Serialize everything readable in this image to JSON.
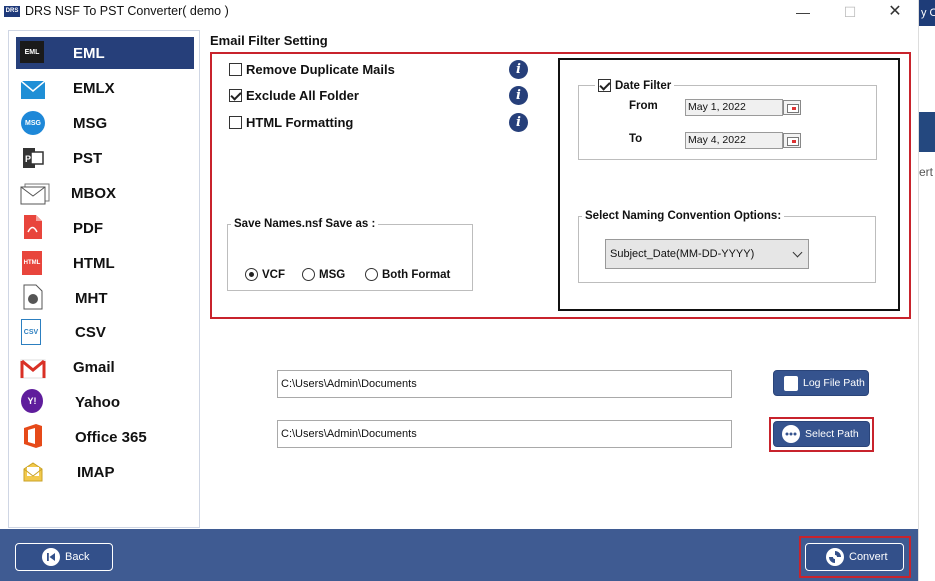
{
  "window": {
    "title": "DRS NSF To PST Converter( demo )",
    "logo_text": "DRS",
    "minimize": "—",
    "maximize": "☐",
    "close": "✕"
  },
  "background_window": {
    "top_text": "y O",
    "body_text": "ert"
  },
  "sidebar": {
    "items": [
      {
        "label": "EML",
        "icon": "eml-icon",
        "active": true
      },
      {
        "label": "EMLX",
        "icon": "envelope-icon"
      },
      {
        "label": "MSG",
        "icon": "msg-icon"
      },
      {
        "label": "PST",
        "icon": "pst-icon"
      },
      {
        "label": "MBOX",
        "icon": "mbox-icon"
      },
      {
        "label": "PDF",
        "icon": "pdf-icon"
      },
      {
        "label": "HTML",
        "icon": "html-icon"
      },
      {
        "label": "MHT",
        "icon": "mht-icon"
      },
      {
        "label": "CSV",
        "icon": "csv-icon"
      },
      {
        "label": "Gmail",
        "icon": "gmail-icon"
      },
      {
        "label": "Yahoo",
        "icon": "yahoo-icon"
      },
      {
        "label": "Office 365",
        "icon": "office365-icon"
      },
      {
        "label": "IMAP",
        "icon": "imap-icon"
      }
    ],
    "icon_text": {
      "eml": "EML",
      "msg": "MSG",
      "html": "HTML",
      "csv": "CSV",
      "yahoo": "Y!"
    }
  },
  "filter": {
    "section_title": "Email Filter Setting",
    "options": [
      {
        "label": "Remove Duplicate Mails",
        "checked": false
      },
      {
        "label": "Exclude All Folder",
        "checked": true
      },
      {
        "label": "HTML Formatting",
        "checked": false
      }
    ],
    "info_glyph": "i",
    "save_as": {
      "legend": "Save Names.nsf Save as :",
      "options": [
        {
          "label": "VCF",
          "selected": true
        },
        {
          "label": "MSG",
          "selected": false
        },
        {
          "label": "Both Format",
          "selected": false
        }
      ]
    },
    "date_filter": {
      "label": "Date Filter",
      "checked": true,
      "from_label": "From",
      "from_value": "May 1, 2022",
      "to_label": "To",
      "to_value": "May 4, 2022"
    },
    "naming": {
      "legend": "Select Naming Convention Options:",
      "selected": "Subject_Date(MM-DD-YYYY)"
    }
  },
  "paths": {
    "log_path": "C:\\Users\\Admin\\Documents",
    "log_button": "Log File Path",
    "output_path": "C:\\Users\\Admin\\Documents",
    "select_button": "Select Path"
  },
  "footer": {
    "back_label": "Back",
    "convert_label": "Convert"
  },
  "colors": {
    "brand_blue": "#263f7a",
    "highlight_red": "#c8232c",
    "footer_blue": "#3f5b92"
  }
}
